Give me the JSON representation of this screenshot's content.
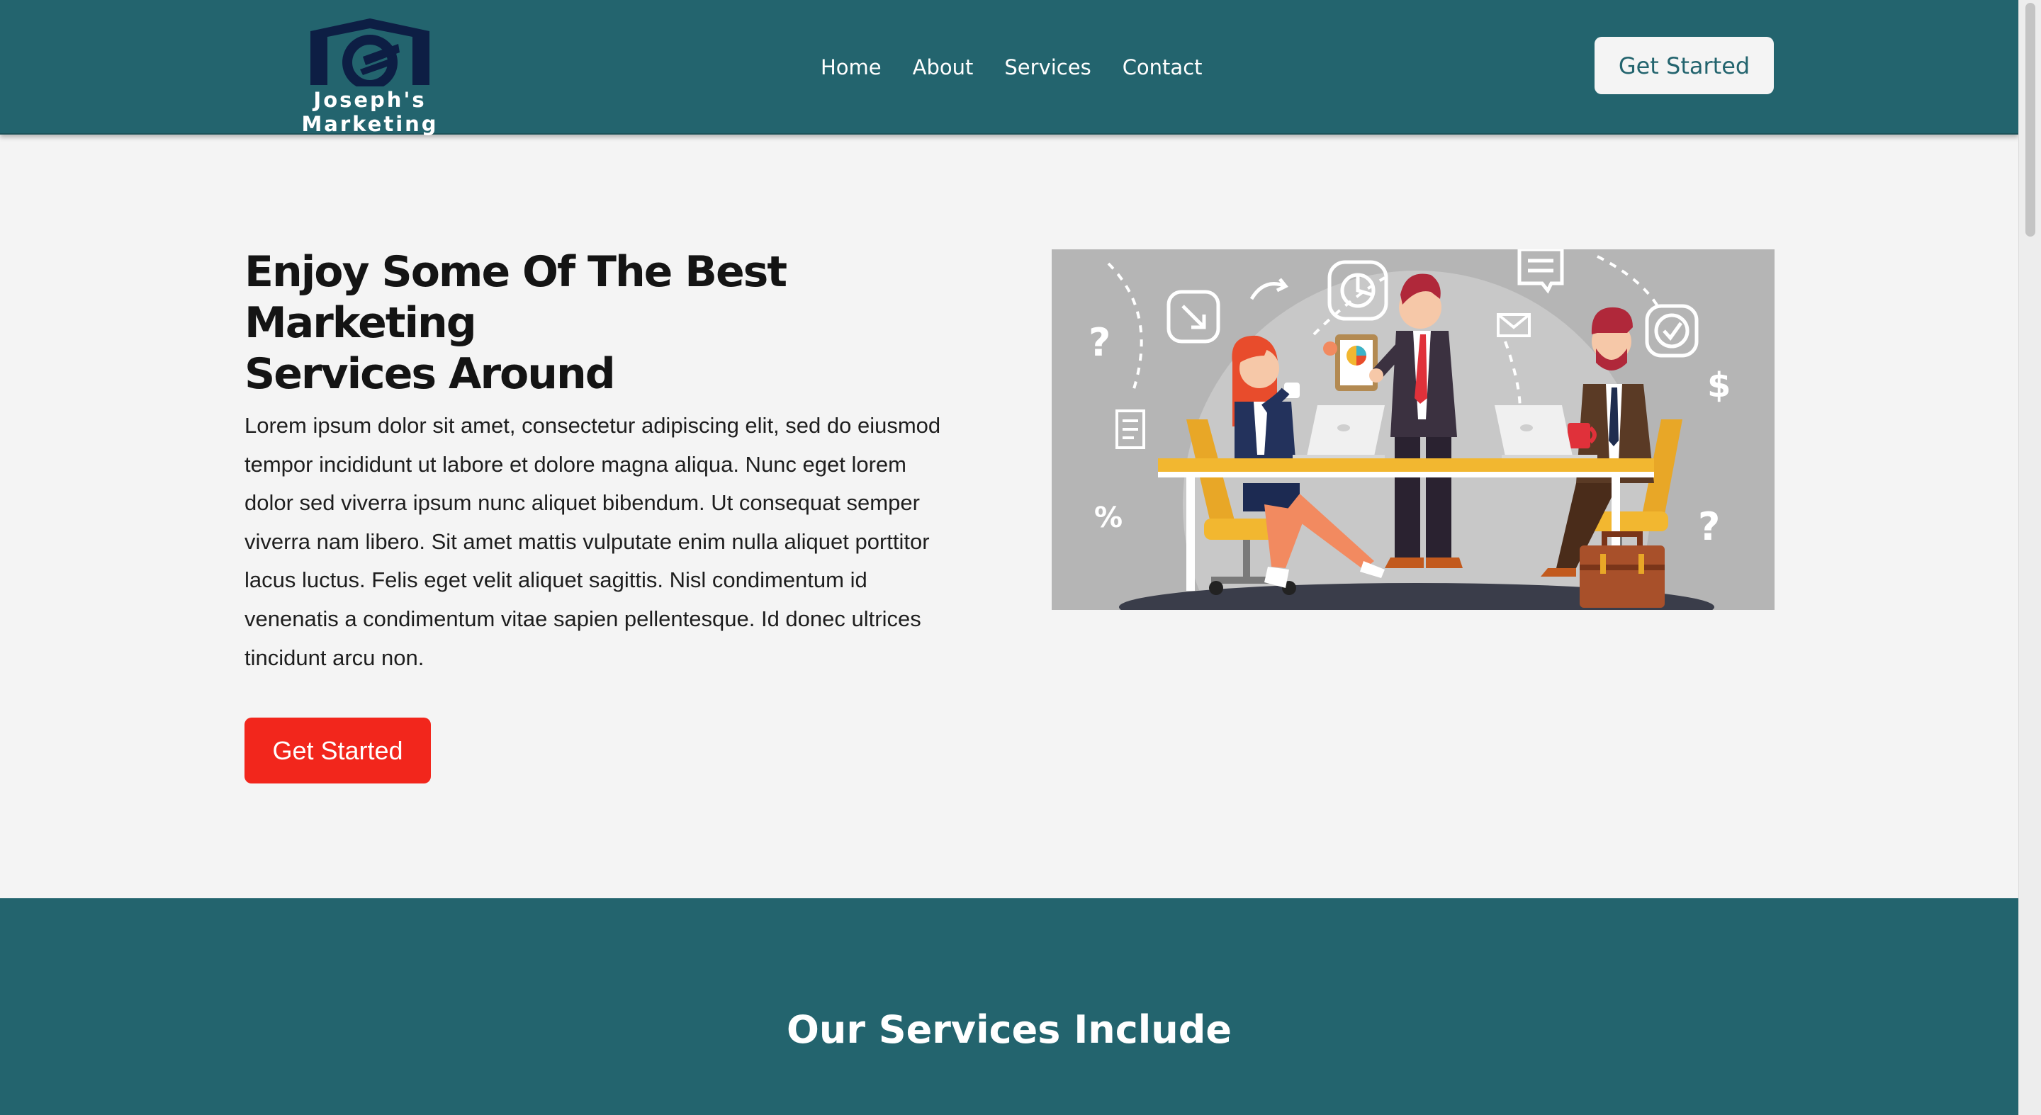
{
  "header": {
    "logo_text": "Joseph's Marketing",
    "nav": [
      {
        "label": "Home"
      },
      {
        "label": "About"
      },
      {
        "label": "Services"
      },
      {
        "label": "Contact"
      }
    ],
    "cta_label": "Get Started"
  },
  "hero": {
    "title_line1": "Enjoy Some Of The Best Marketing",
    "title_line2": "Services Around",
    "body_lines": [
      "Lorem ipsum dolor sit amet, consectetur adipiscing elit, sed do eiusmod",
      "tempor incididunt ut labore et dolore magna aliqua. Nunc eget lorem",
      "dolor sed viverra ipsum nunc aliquet bibendum. Ut consequat semper",
      "viverra nam libero. Sit amet mattis vulputate enim nulla aliquet porttitor",
      "lacus luctus. Felis eget velit aliquet sagittis. Nisl condimentum id",
      "venenatis a condimentum vitae sapien pellentesque. Id donec ultrices",
      "tincidunt arcu non."
    ],
    "cta_label": "Get Started",
    "illustration_text": {
      "question": "?",
      "dollar": "$",
      "percent": "%"
    }
  },
  "services": {
    "title": "Our Services Include"
  },
  "colors": {
    "primary": "#23646e",
    "accent": "#f2261c",
    "background": "#f4f4f4",
    "logo_navy": "#0d1e44"
  }
}
